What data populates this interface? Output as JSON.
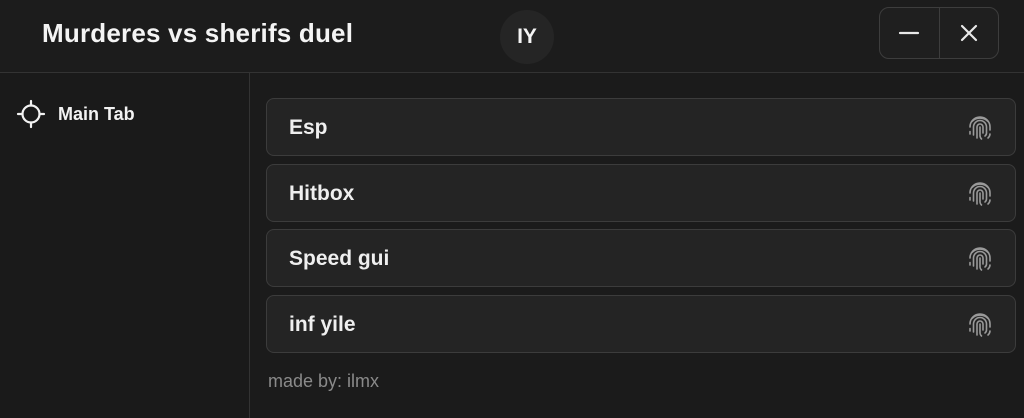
{
  "window": {
    "title": "Murderes vs sherifs duel",
    "badge": "IY",
    "minimize_icon": "minus-icon",
    "close_icon": "close-icon"
  },
  "sidebar": {
    "tabs": [
      {
        "label": "Main Tab",
        "icon": "crosshair-icon"
      }
    ]
  },
  "main": {
    "buttons": [
      {
        "label": "Esp",
        "icon": "fingerprint-icon"
      },
      {
        "label": "Hitbox",
        "icon": "fingerprint-icon"
      },
      {
        "label": "Speed gui",
        "icon": "fingerprint-icon"
      },
      {
        "label": "inf yile",
        "icon": "fingerprint-icon"
      }
    ],
    "footer": "made by: ilmx"
  },
  "colors": {
    "background": "#1b1b1b",
    "button_bg": "#242424",
    "border": "#3c3c3c",
    "text": "#f2f2f2",
    "muted_text": "#8a8a8a"
  }
}
